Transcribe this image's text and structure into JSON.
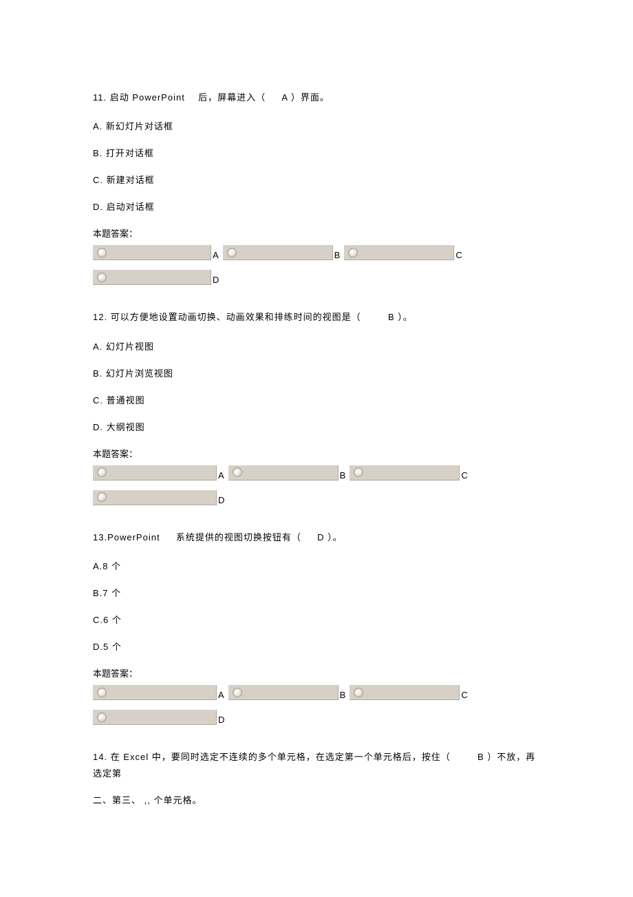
{
  "answerLabel": "本题答案：",
  "letters": {
    "a": "A",
    "b": "B",
    "c": "C",
    "d": "D"
  },
  "q11": {
    "stem_pre": "11. 启动 PowerPoint",
    "stem_post": "后，屏幕进入（",
    "stem_ans": "A ）界面。",
    "optA": "A. 新幻灯片对话框",
    "optB": "B. 打开对话框",
    "optC": "C.  新建对话框",
    "optD": "D.  启动对话框"
  },
  "q12": {
    "stem_pre": "12. 可以方便地设置动画切换、动画效果和排练时间的视图是（",
    "stem_ans": "B  ）。",
    "optA": "A. 幻灯片视图",
    "optB": "B. 幻灯片浏览视图",
    "optC": "C.  普通视图",
    "optD": "D.  大纲视图"
  },
  "q13": {
    "stem_pre": "13.PowerPoint",
    "stem_post": "系统提供的视图切换按钮有（",
    "stem_ans": "D ）。",
    "optA": "A.8 个",
    "optB": "B.7 个",
    "optC": "C.6 个",
    "optD": "D.5 个"
  },
  "q14": {
    "line1_a": "14. 在 Excel  中，要同时选定不连续的多个单元格，在选定第一个单元格后，按住（",
    "line1_b": "B ）不放，再选定第",
    "line2": "二、第三、 ,,  个单元格。"
  }
}
